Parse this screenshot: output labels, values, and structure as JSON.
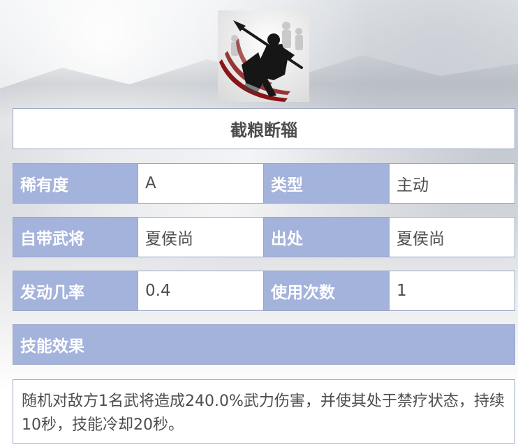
{
  "skill": {
    "name": "截粮断辎"
  },
  "info_rows": [
    {
      "left_label": "稀有度",
      "left_value": "A",
      "right_label": "类型",
      "right_value": "主动"
    },
    {
      "left_label": "自带武将",
      "left_value": "夏侯尚",
      "right_label": "出处",
      "right_value": "夏侯尚"
    },
    {
      "left_label": "发动几率",
      "left_value": "0.4",
      "right_label": "使用次数",
      "right_value": "1"
    }
  ],
  "effect": {
    "header": "技能效果",
    "text": "随机对敌方1名武将造成240.0%武力伤害，并使其处于禁疗状态，持续10秒，技能冷却20秒。"
  },
  "colors": {
    "label_bg": "#a4b3dc",
    "border": "#9aa6c6",
    "text": "#4d4d4d"
  },
  "icons": {
    "skill_art": "warrior-silhouette-icon"
  }
}
